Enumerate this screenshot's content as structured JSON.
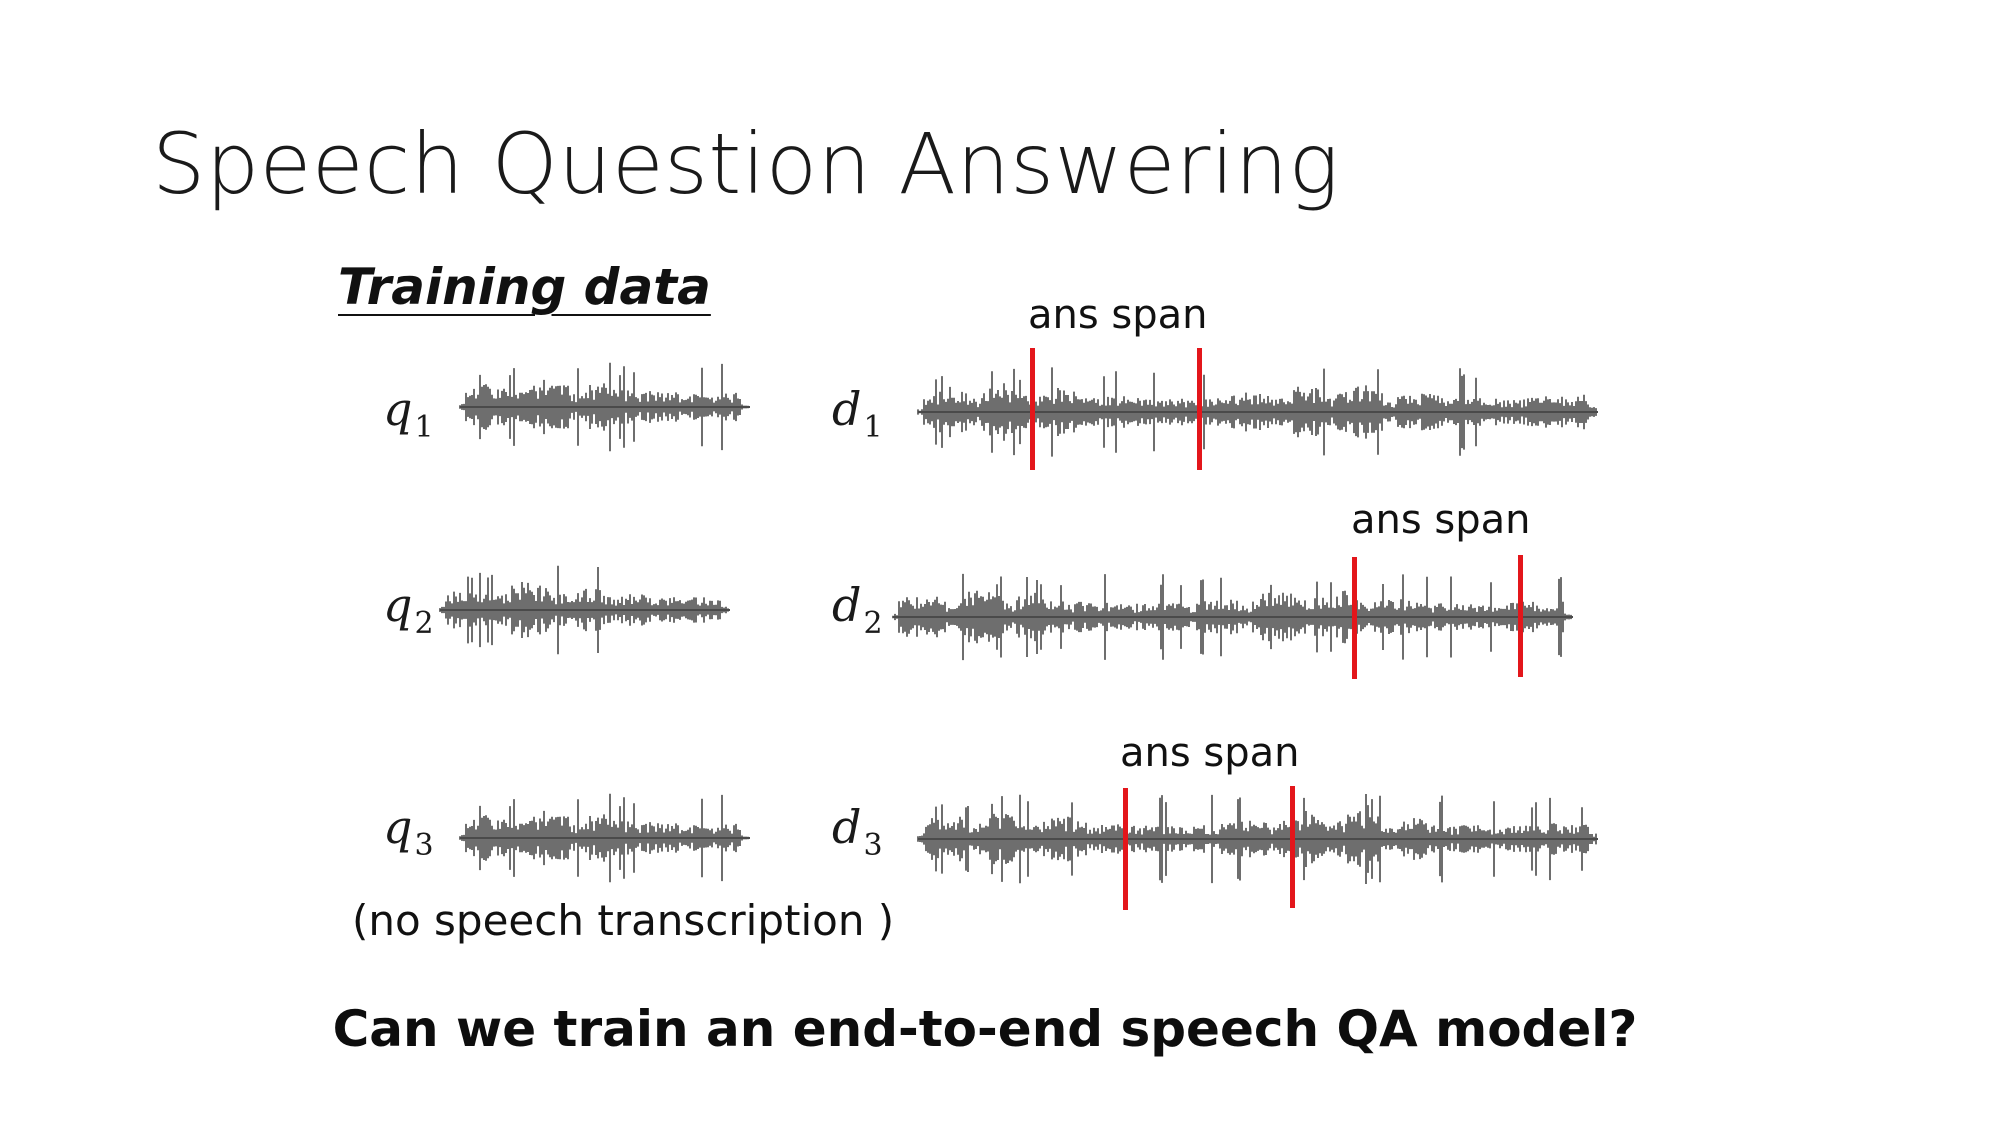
{
  "title": "Speech Question Answering",
  "section_heading": "Training data",
  "waveform_color": "#4a4a4a",
  "span_color": "#e3161b",
  "queries": [
    {
      "symbol": "q",
      "index": "1"
    },
    {
      "symbol": "q",
      "index": "2"
    },
    {
      "symbol": "q",
      "index": "3"
    }
  ],
  "documents": [
    {
      "symbol": "d",
      "index": "1"
    },
    {
      "symbol": "d",
      "index": "2"
    },
    {
      "symbol": "d",
      "index": "3"
    }
  ],
  "ans_span_label": "ans span",
  "note": "(no speech transcription )",
  "question": "Can we train an end-to-end speech QA model?"
}
